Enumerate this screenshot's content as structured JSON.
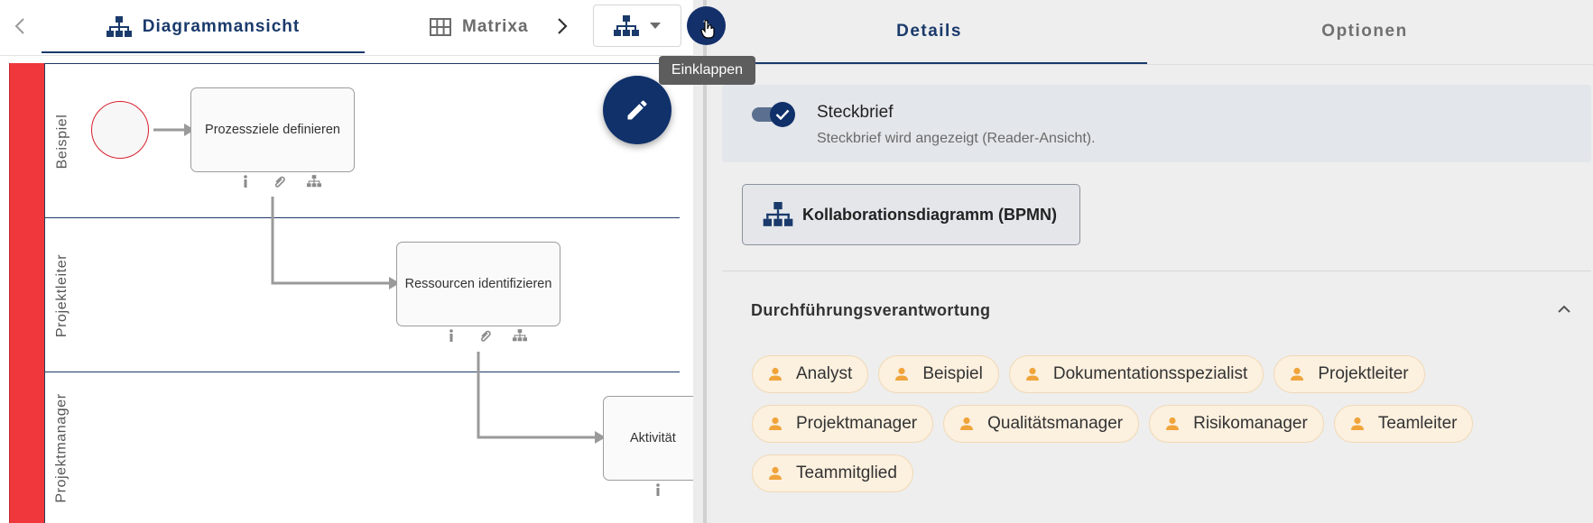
{
  "left": {
    "tabs": {
      "diagram_label": "Diagrammansicht",
      "matrix_label": "Matrixa"
    },
    "lanes": [
      {
        "label": "Beispiel"
      },
      {
        "label": "Projektleiter"
      },
      {
        "label": "Projektmanager"
      }
    ],
    "tasks": [
      {
        "label": "Prozessziele definieren"
      },
      {
        "label": "Ressourcen identifizieren"
      },
      {
        "label": "Aktivität"
      }
    ],
    "task_icons": {
      "info": "info-icon",
      "attachment": "paperclip-icon",
      "subprocess": "hierarchy-icon"
    }
  },
  "tooltip": "Einklappen",
  "right": {
    "tabs": {
      "details_label": "Details",
      "options_label": "Optionen",
      "active": "details"
    },
    "profile": {
      "title": "Steckbrief",
      "subtitle": "Steckbrief wird angezeigt (Reader-Ansicht).",
      "enabled": true
    },
    "bpmn_button": {
      "label": "Kollaborationsdiagramm (BPMN)"
    },
    "responsibility": {
      "title": "Durchführungsverantwortung",
      "expanded": true,
      "roles": [
        "Analyst",
        "Beispiel",
        "Dokumentationsspezialist",
        "Projektleiter",
        "Projektmanager",
        "Qualitätsmanager",
        "Risikomanager",
        "Teamleiter",
        "Teammitglied"
      ]
    }
  },
  "colors": {
    "primary": "#10306a",
    "pool_band": "#f0373c",
    "start_event_border": "#d81f2c",
    "chip_bg": "#fcf0df",
    "chip_icon": "#f0a43a",
    "panel_bg": "#eeeeee"
  }
}
